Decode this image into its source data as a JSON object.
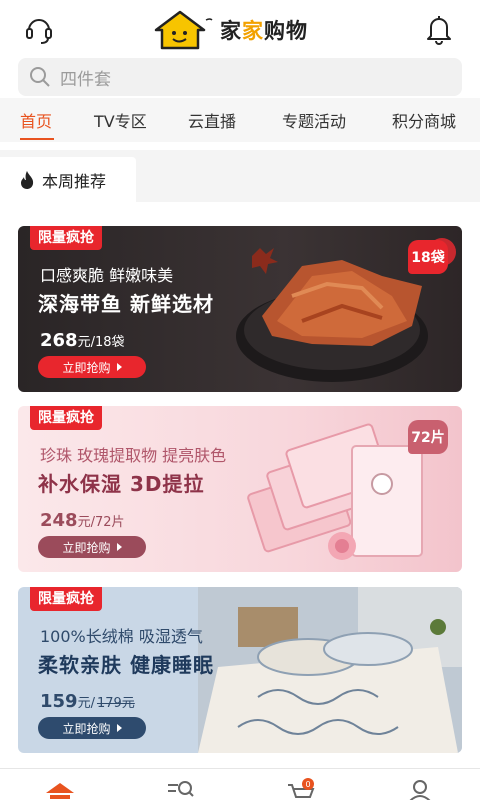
{
  "header": {
    "brand_prefix": "家",
    "brand_accent": "家",
    "brand_suffix": "购物",
    "left_icon": "headset-icon",
    "right_icon": "bell-icon"
  },
  "search": {
    "placeholder": "四件套",
    "icon": "search-icon"
  },
  "tabs": [
    {
      "label": "首页",
      "active": true
    },
    {
      "label": "TV专区",
      "active": false
    },
    {
      "label": "云直播",
      "active": false
    },
    {
      "label": "专题活动",
      "active": false
    },
    {
      "label": "积分商城",
      "active": false
    }
  ],
  "section": {
    "title": "本周推荐",
    "icon": "flame-icon"
  },
  "cards": [
    {
      "badge": "限量疯抢",
      "line1": "口感爽脆 鲜嫩味美",
      "line2": "深海带鱼 新鲜选材",
      "price_big": "268",
      "price_small": "元/18袋",
      "button": "立即抢购",
      "tag": "18袋"
    },
    {
      "badge": "限量疯抢",
      "line1": "珍珠 玫瑰提取物 提亮肤色",
      "line2": "补水保湿 3D提拉",
      "price_big": "248",
      "price_small": "元/72片",
      "button": "立即抢购",
      "tag": "72片"
    },
    {
      "badge": "限量疯抢",
      "line1": "100%长绒棉 吸湿透气",
      "line2": "柔软亲肤 健康睡眠",
      "price_big": "159",
      "price_small": "元/",
      "price_strike": "179元",
      "button": "立即抢购"
    }
  ],
  "bottom_nav": {
    "items": [
      "home-icon",
      "category-search-icon",
      "cart-icon",
      "user-icon"
    ],
    "cart_count": "0"
  },
  "colors": {
    "accent": "#e8531f",
    "badge_red": "#e8262d",
    "logo_yellow": "#f2a100"
  }
}
